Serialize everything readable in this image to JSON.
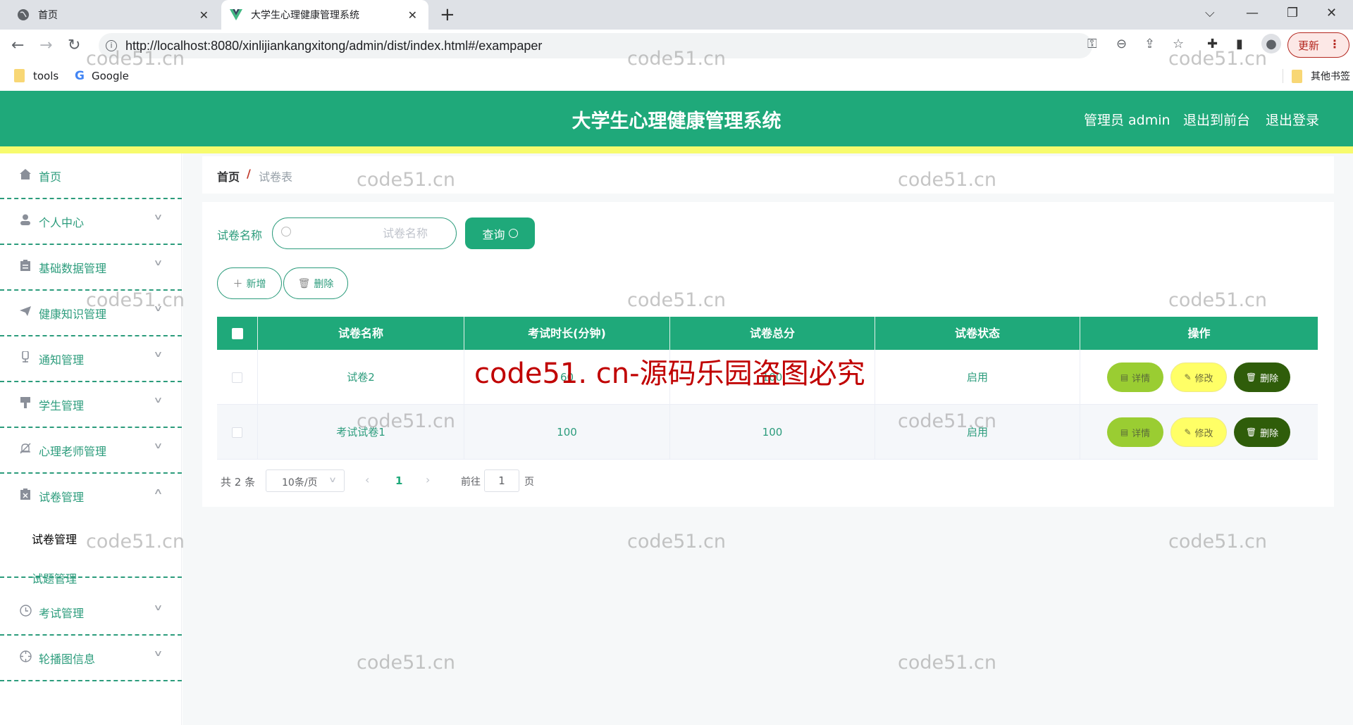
{
  "browser": {
    "tabs": [
      {
        "title": "首页",
        "icon": "globe-icon",
        "active": false
      },
      {
        "title": "大学生心理健康管理系统",
        "icon": "vue-logo-icon",
        "active": true
      }
    ],
    "new_tab": "+",
    "url": "http://localhost:8080/xinlijiankangxitong/admin/dist/index.html#/exampaper",
    "update_label": "更新",
    "bookmarks": [
      {
        "label": "tools",
        "icon": "folder-icon"
      },
      {
        "label": "Google",
        "icon": "google-icon"
      }
    ],
    "other_bookmarks": "其他书签"
  },
  "header": {
    "title": "大学生心理健康管理系统",
    "user": "管理员 admin",
    "to_frontend": "退出到前台",
    "logout": "退出登录"
  },
  "sidebar": {
    "items": [
      {
        "label": "首页",
        "icon": "home-icon",
        "expandable": false
      },
      {
        "label": "个人中心",
        "icon": "user-icon",
        "expandable": true
      },
      {
        "label": "基础数据管理",
        "icon": "clipboard-icon",
        "expandable": true
      },
      {
        "label": "健康知识管理",
        "icon": "send-icon",
        "expandable": true
      },
      {
        "label": "通知管理",
        "icon": "microphone-icon",
        "expandable": true
      },
      {
        "label": "学生管理",
        "icon": "brush-icon",
        "expandable": true
      },
      {
        "label": "心理老师管理",
        "icon": "bell-off-icon",
        "expandable": true
      },
      {
        "label": "试卷管理",
        "icon": "document-remove-icon",
        "expandable": true,
        "expanded": true,
        "children": [
          {
            "label": "试卷管理",
            "active": true
          },
          {
            "label": "试题管理",
            "active": false
          }
        ]
      },
      {
        "label": "考试管理",
        "icon": "clock-icon",
        "expandable": true
      },
      {
        "label": "轮播图信息",
        "icon": "crosshair-icon",
        "expandable": true
      }
    ]
  },
  "breadcrumb": {
    "home": "首页",
    "separator": "/",
    "current": "试卷表"
  },
  "search": {
    "label": "试卷名称",
    "value": "",
    "placeholder": "试卷名称",
    "query_label": "查询"
  },
  "toolbar": {
    "add_label": "新增",
    "delete_label": "删除"
  },
  "table": {
    "columns": [
      "试卷名称",
      "考试时长(分钟)",
      "试卷总分",
      "试卷状态",
      "操作"
    ],
    "rows": [
      {
        "name": "试卷2",
        "duration": "60",
        "score": "100",
        "status": "启用"
      },
      {
        "name": "考试试卷1",
        "duration": "100",
        "score": "100",
        "status": "启用"
      }
    ],
    "row_actions": {
      "detail": "详情",
      "edit": "修改",
      "delete": "删除"
    }
  },
  "pagination": {
    "total": "共 2 条",
    "page_size": "10条/页",
    "current_page": "1",
    "goto_label": "前往",
    "goto_value": "1",
    "page_suffix": "页"
  },
  "watermarks": {
    "text": "code51.cn",
    "banner": "code51. cn-源码乐园盗图必究"
  },
  "colors": {
    "primary": "#1fa97a",
    "accent_yellow": "#f7fb6d",
    "detail_btn": "#9acd32",
    "edit_btn": "#ffff66",
    "delete_btn": "#2f5d0a"
  }
}
